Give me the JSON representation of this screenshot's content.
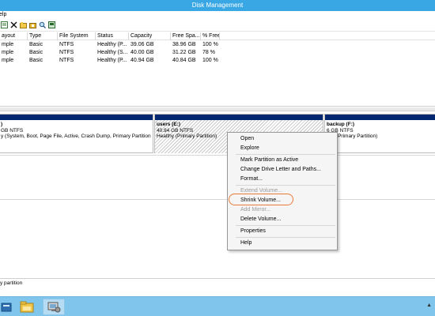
{
  "window": {
    "title": "Disk Management"
  },
  "menubar": {
    "item_help": "elp"
  },
  "toolbar": {
    "icons": [
      "properties-icon",
      "delete-icon",
      "folder-open-icon",
      "folder-icon",
      "magnifier-icon",
      "disk-icon"
    ]
  },
  "volume_table": {
    "headers": [
      "ayout",
      "Type",
      "File System",
      "Status",
      "Capacity",
      "Free Spa...",
      "% Free"
    ],
    "rows": [
      [
        "mple",
        "Basic",
        "NTFS",
        "Healthy (P...",
        "39.06 GB",
        "38.96 GB",
        "100 %"
      ],
      [
        "mple",
        "Basic",
        "NTFS",
        "Healthy (S...",
        "40.00 GB",
        "31.22 GB",
        "78 %"
      ],
      [
        "mple",
        "Basic",
        "NTFS",
        "Healthy (P...",
        "40.94 GB",
        "40.84 GB",
        "100 %"
      ]
    ]
  },
  "disk_graph": {
    "partitions": [
      {
        "name": ")",
        "size": "GB NTFS",
        "status": "y (System, Boot, Page File, Active, Crash Dump, Primary Partition"
      },
      {
        "name": "users  (E:)",
        "size": "40.94 GB NTFS",
        "status": "Healthy (Primary Partition)"
      },
      {
        "name": "backup  (F:)",
        "size": "6 GB NTFS",
        "status": "lthy (Primary Partition)"
      }
    ]
  },
  "legend": {
    "primary_partition": "y partition"
  },
  "context_menu": {
    "items": [
      {
        "label": "Open",
        "enabled": true
      },
      {
        "label": "Explore",
        "enabled": true
      },
      {
        "label": "Mark Partition as Active",
        "enabled": true
      },
      {
        "label": "Change Drive Letter and Paths...",
        "enabled": true
      },
      {
        "label": "Format...",
        "enabled": true
      },
      {
        "label": "Extend Volume...",
        "enabled": false
      },
      {
        "label": "Shrink Volume...",
        "enabled": true
      },
      {
        "label": "Add Mirror...",
        "enabled": false
      },
      {
        "label": "Delete Volume...",
        "enabled": true
      },
      {
        "label": "Properties",
        "enabled": true
      },
      {
        "label": "Help",
        "enabled": true
      }
    ]
  },
  "taskbar": {
    "tray_arrow": "▲"
  },
  "colors": {
    "titlebar": "#39a7e4",
    "partition_bar": "#002870",
    "taskbar": "#7fc5ec",
    "highlight": "#e87a39"
  }
}
